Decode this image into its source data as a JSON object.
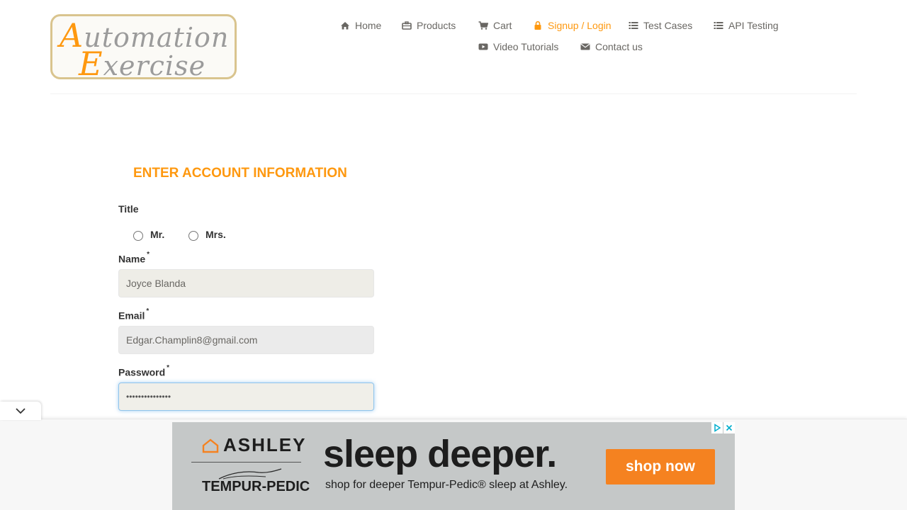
{
  "logo": {
    "line1_cap": "A",
    "line1_rest": "utomation",
    "line2_cap": "E",
    "line2_rest": "xercise"
  },
  "nav": {
    "items": [
      {
        "label": "Home",
        "icon": "home-icon"
      },
      {
        "label": "Products",
        "icon": "briefcase-icon"
      },
      {
        "label": "Cart",
        "icon": "cart-icon"
      },
      {
        "label": "Signup / Login",
        "icon": "lock-icon",
        "active": true
      },
      {
        "label": "Test Cases",
        "icon": "list-icon"
      },
      {
        "label": "API Testing",
        "icon": "list-icon"
      },
      {
        "label": "Video Tutorials",
        "icon": "youtube-icon"
      },
      {
        "label": "Contact us",
        "icon": "envelope-icon"
      }
    ]
  },
  "form": {
    "heading": "ENTER ACCOUNT INFORMATION",
    "title_label": "Title",
    "title_options": [
      "Mr.",
      "Mrs."
    ],
    "name_label": "Name",
    "name_value": "Joyce Blanda",
    "email_label": "Email",
    "email_value": "Edgar.Champlin8@gmail.com",
    "password_label": "Password",
    "password_value": "•••••••••••••••",
    "required_mark": "*"
  },
  "ad": {
    "brand1": "ASHLEY",
    "brand2": "TEMPUR-PEDIC",
    "headline": "sleep deeper.",
    "subtext": "shop for deeper Tempur-Pedic® sleep at Ashley.",
    "cta": "shop now"
  },
  "colors": {
    "accent": "#fe980f",
    "nav_text": "#696763",
    "ad_cta": "#f58220"
  }
}
